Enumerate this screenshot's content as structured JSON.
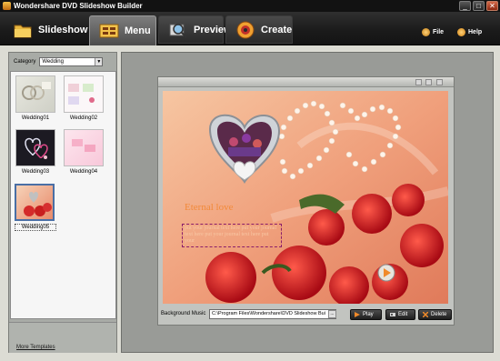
{
  "window": {
    "title": "Wondershare DVD Slideshow Builder",
    "controls": [
      "_",
      "□",
      "✕"
    ]
  },
  "toolbar": {
    "tabs": [
      {
        "label": "Slideshow",
        "icon": "folder-icon"
      },
      {
        "label": "Menu",
        "icon": "menu-icon"
      },
      {
        "label": "Preview",
        "icon": "magnifier-icon"
      },
      {
        "label": "Create",
        "icon": "disc-icon"
      }
    ],
    "active_tab": "Menu",
    "file_label": "File",
    "help_label": "Help"
  },
  "left_panel": {
    "category_label": "Category",
    "category_value": "Wedding",
    "templates": [
      {
        "label": "Wedding01"
      },
      {
        "label": "Wedding02"
      },
      {
        "label": "Wedding03"
      },
      {
        "label": "Wedding04"
      },
      {
        "label": "Wedding05"
      }
    ],
    "selected_template": "Wedding05",
    "more_templates": "More Templates"
  },
  "editor": {
    "title_text": "Eternal love",
    "journal_text": "put your journal text here put your journal text here put your journal text here put your",
    "background_music_label": "Background Music",
    "background_music_path": "C:\\Program Files\\Wondershare\\DVD Slideshow Bui",
    "browse_label": "...",
    "play_label": "Play",
    "edit_label": "Edit",
    "delete_label": "Delete"
  },
  "colors": {
    "accent": "#f28a3a",
    "selection": "#4a6fa5",
    "toolbar": "#1a1a1a"
  }
}
